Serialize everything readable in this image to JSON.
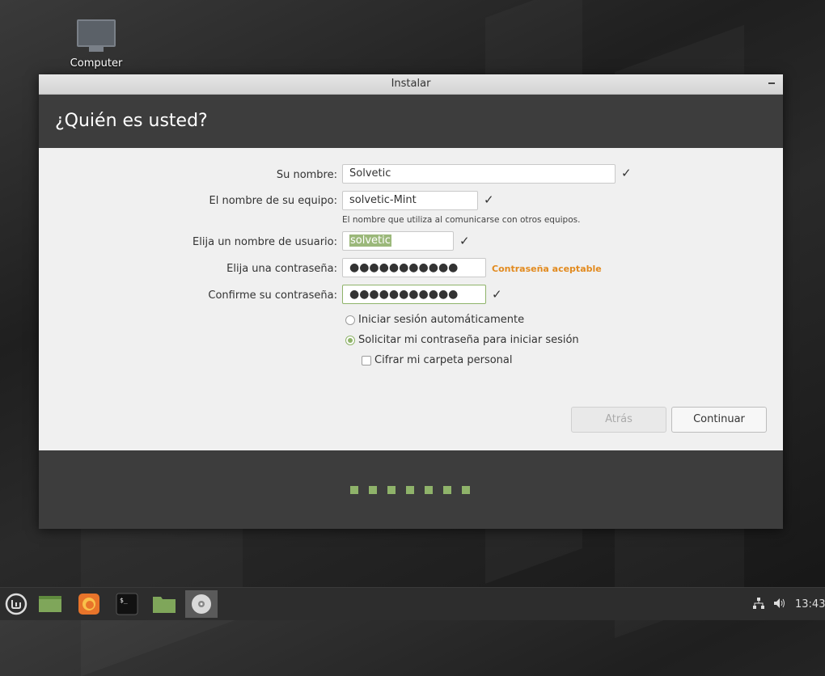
{
  "desktop": {
    "icon_label": "Computer"
  },
  "window": {
    "title": "Instalar",
    "heading": "¿Quién es usted?"
  },
  "form": {
    "name_label": "Su nombre:",
    "name_value": "Solvetic",
    "computer_label": "El nombre de su equipo:",
    "computer_value": "solvetic-Mint",
    "computer_hint": "El nombre que utiliza al comunicarse con otros equipos.",
    "username_label": "Elija un nombre de usuario:",
    "username_value": "solvetic",
    "password_label": "Elija una contraseña:",
    "password_value": "●●●●●●●●●●●",
    "password_strength": "Contraseña aceptable",
    "confirm_label": "Confirme su contraseña:",
    "confirm_value": "●●●●●●●●●●●",
    "check_mark": "✓"
  },
  "options": {
    "auto_login": "Iniciar sesión automáticamente",
    "require_password": "Solicitar mi contraseña para iniciar sesión",
    "encrypt_home": "Cifrar mi carpeta personal"
  },
  "buttons": {
    "back": "Atrás",
    "continue": "Continuar"
  },
  "progress": {
    "steps_total": 7
  },
  "taskbar": {
    "clock": "13:43"
  },
  "colors": {
    "accent": "#8fb36a",
    "warning": "#e28a1e",
    "header": "#3d3d3d"
  }
}
